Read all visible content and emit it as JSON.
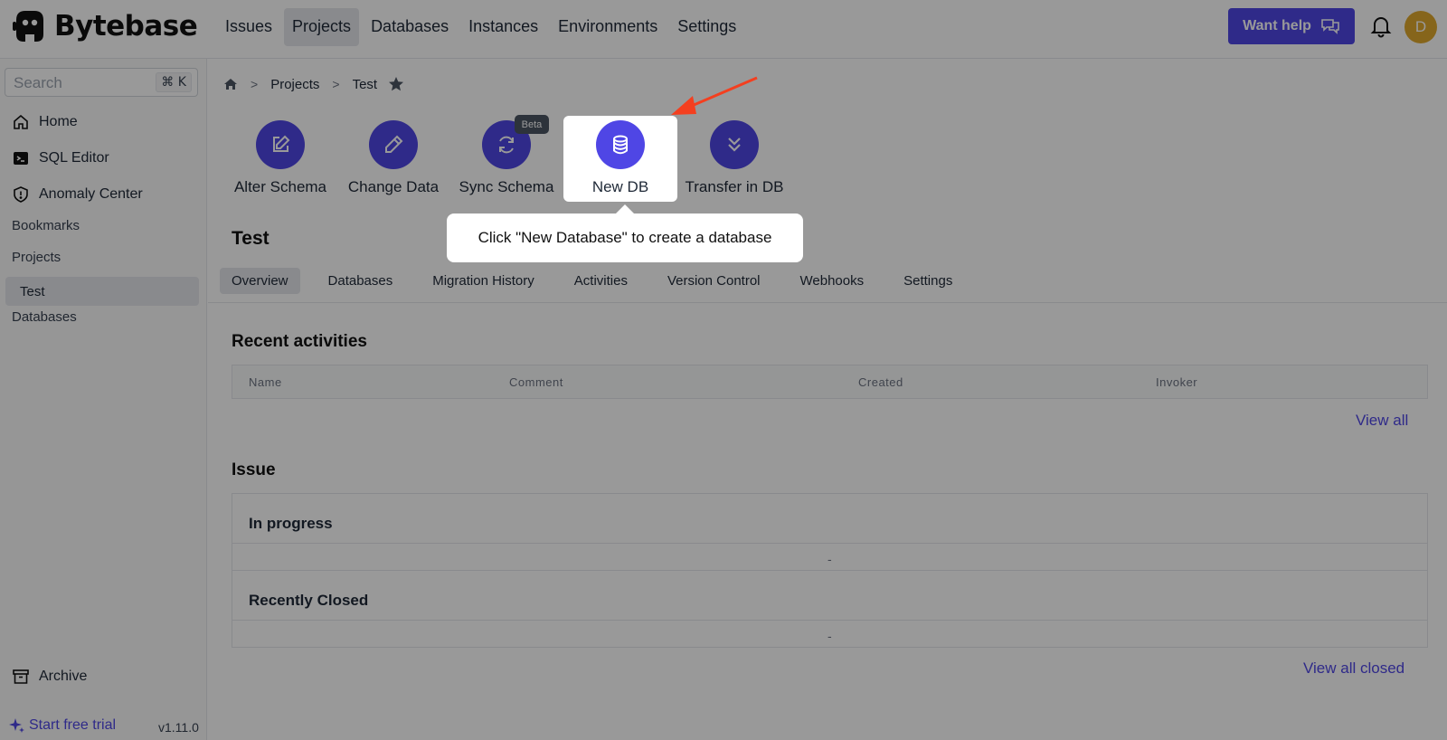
{
  "app": {
    "name": "Bytebase",
    "nav": [
      "Issues",
      "Projects",
      "Databases",
      "Instances",
      "Environments",
      "Settings"
    ],
    "help_label": "Want help",
    "avatar_initial": "D",
    "accent_color": "#4f46e5"
  },
  "sidebar": {
    "search_placeholder": "Search",
    "search_shortcut": "⌘ K",
    "home": "Home",
    "sql_editor": "SQL Editor",
    "anomaly_center": "Anomaly Center",
    "bookmarks": "Bookmarks",
    "projects": "Projects",
    "project_item": "Test",
    "databases": "Databases",
    "archive": "Archive",
    "trial": "Start free trial",
    "version": "v1.11.0"
  },
  "breadcrumb": {
    "projects": "Projects",
    "current": "Test"
  },
  "quick_actions": {
    "alter_schema": "Alter Schema",
    "change_data": "Change Data",
    "sync_schema": "Sync Schema",
    "beta": "Beta",
    "new_db": "New DB",
    "transfer_db": "Transfer in DB"
  },
  "project": {
    "title": "Test",
    "tabs": [
      "Overview",
      "Databases",
      "Migration History",
      "Activities",
      "Version Control",
      "Webhooks",
      "Settings"
    ]
  },
  "recent_activities": {
    "title": "Recent activities",
    "columns": [
      "Name",
      "Comment",
      "Created",
      "Invoker"
    ],
    "view_all": "View all"
  },
  "issue": {
    "title": "Issue",
    "in_progress": "In progress",
    "in_progress_empty": "-",
    "recently_closed": "Recently Closed",
    "recently_closed_empty": "-",
    "view_all_closed": "View all closed"
  },
  "tour": {
    "tooltip": "Click \"New Database\" to create a database"
  }
}
